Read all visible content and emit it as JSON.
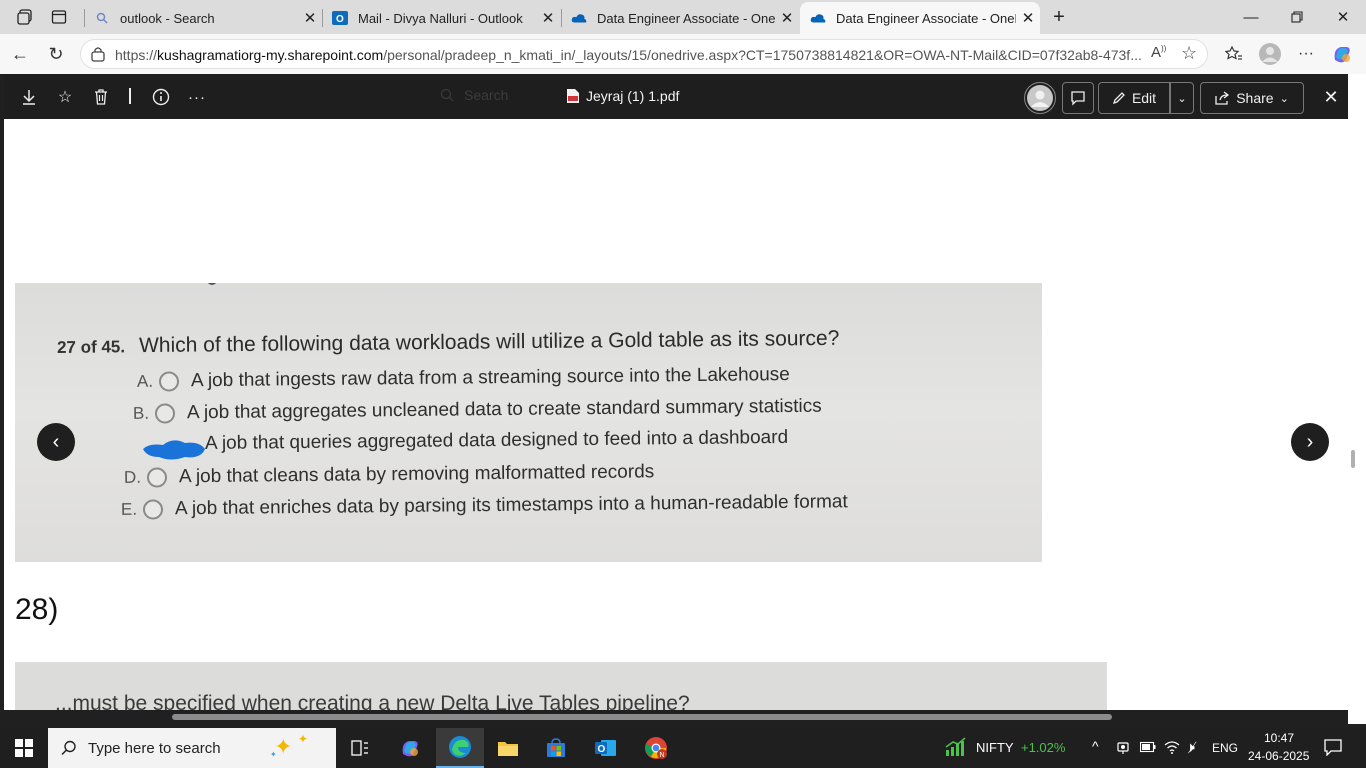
{
  "browser": {
    "tabs": [
      {
        "title": "outlook - Search",
        "icon": "search-icon"
      },
      {
        "title": "Mail - Divya Nalluri - Outlook",
        "icon": "outlook-icon"
      },
      {
        "title": "Data Engineer Associate - OneDri",
        "icon": "onedrive-icon"
      },
      {
        "title": "Data Engineer Associate - OneDri",
        "icon": "onedrive-icon",
        "active": true
      }
    ],
    "url_host": "kushagramatiorg-my.sharepoint.com",
    "url_rest": "/personal/pradeep_n_kmati_in/_layouts/15/onedrive.aspx?CT=1750738814821&OR=OWA-NT-Mail&CID=07f32ab8-473f...",
    "url_prefix": "https://"
  },
  "viewer": {
    "search_placeholder": "Search",
    "doc_name": "Jeyraj (1) 1.pdf",
    "edit_label": "Edit",
    "share_label": "Share"
  },
  "page": {
    "question_number": "27 of 45.",
    "question_text": "Which of the following data workloads will utilize a Gold table as its source?",
    "options": [
      {
        "letter": "A.",
        "text": "A job that ingests raw data from a streaming source into the Lakehouse"
      },
      {
        "letter": "B.",
        "text": "A job that aggregates uncleaned data to create standard summary statistics"
      },
      {
        "letter": "",
        "text": "A job that queries aggregated data designed to feed into a dashboard",
        "selected": true
      },
      {
        "letter": "D.",
        "text": "A job that cleans data by removing malformatted records"
      },
      {
        "letter": "E.",
        "text": "A job that enriches data by parsing its timestamps into a human-readable format"
      }
    ],
    "next_heading": "28)",
    "next_question_partial": "...must be specified when creating a new Delta Live Tables pipeline?"
  },
  "taskbar": {
    "search_placeholder": "Type here to search",
    "stock_name": "NIFTY",
    "stock_change": "+1.02%",
    "lang": "ENG",
    "time": "10:47",
    "date": "24-06-2025"
  },
  "colors": {
    "accent_green": "#4cc24c",
    "scribble_blue": "#1a73d9"
  }
}
